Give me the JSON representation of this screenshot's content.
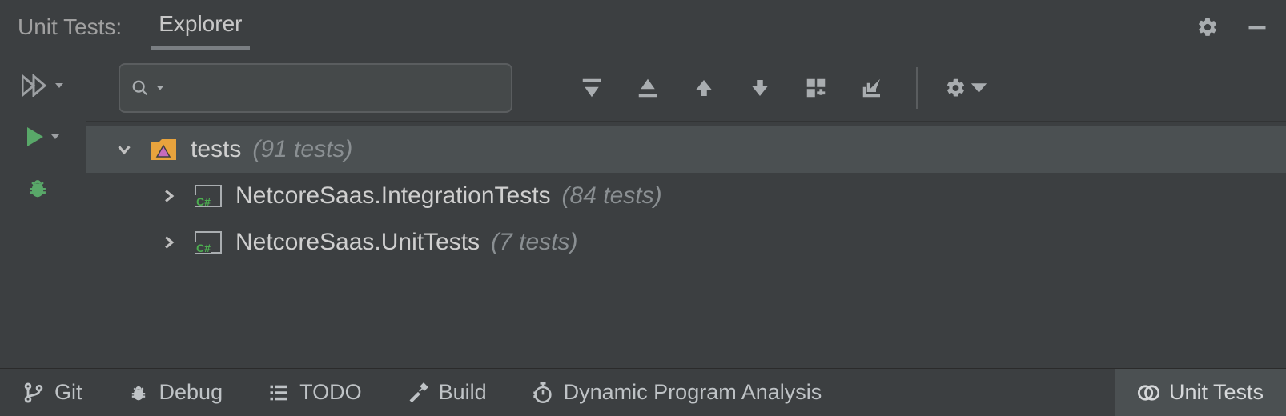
{
  "panel": {
    "title": "Unit Tests:",
    "active_tab": "Explorer"
  },
  "search": {
    "placeholder": "",
    "value": ""
  },
  "tree": {
    "root": {
      "name": "tests",
      "count": "(91 tests)"
    },
    "children": [
      {
        "name": "NetcoreSaas.IntegrationTests",
        "count": "(84 tests)"
      },
      {
        "name": "NetcoreSaas.UnitTests",
        "count": "(7 tests)"
      }
    ]
  },
  "statusbar": {
    "items": [
      {
        "label": "Git"
      },
      {
        "label": "Debug"
      },
      {
        "label": "TODO"
      },
      {
        "label": "Build"
      },
      {
        "label": "Dynamic Program Analysis"
      },
      {
        "label": "Unit Tests"
      }
    ],
    "active_index": 5
  },
  "colors": {
    "bg": "#3c3f41",
    "selected": "#4b5052",
    "accent_green": "#59a869",
    "accent_orange": "#e8a33d",
    "accent_magenta": "#c66bbd",
    "cs_green": "#4caf50"
  }
}
